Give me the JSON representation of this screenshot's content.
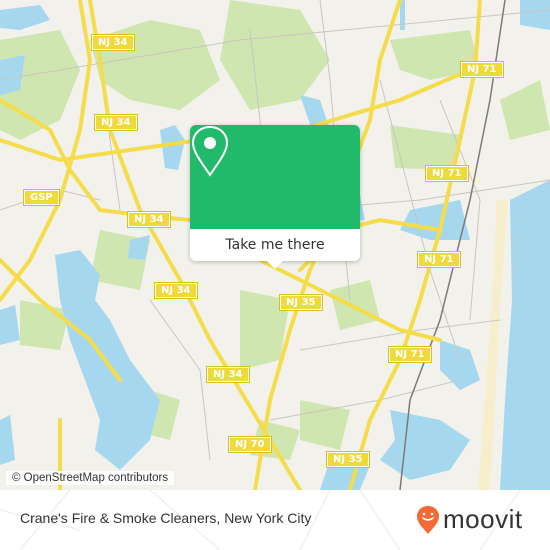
{
  "map": {
    "road_labels": [
      {
        "id": "nj34-a",
        "text": "NJ 34"
      },
      {
        "id": "nj34-b",
        "text": "NJ 34"
      },
      {
        "id": "gsp",
        "text": "GSP"
      },
      {
        "id": "nj34-c",
        "text": "NJ 34"
      },
      {
        "id": "nj34-d",
        "text": "NJ 34"
      },
      {
        "id": "nj34-e",
        "text": "NJ 34"
      },
      {
        "id": "nj35-a",
        "text": "NJ 35"
      },
      {
        "id": "nj70",
        "text": "NJ 70"
      },
      {
        "id": "nj35-b",
        "text": "NJ 35"
      },
      {
        "id": "nj71-a",
        "text": "NJ 71"
      },
      {
        "id": "nj71-b",
        "text": "NJ 71"
      },
      {
        "id": "nj71-c",
        "text": "NJ 71"
      },
      {
        "id": "nj71-d",
        "text": "NJ 71"
      }
    ],
    "colors": {
      "land": "#f2f1ec",
      "park": "#cfe6b0",
      "water": "#a5d8ee",
      "road": "#f5dc4a",
      "beach": "#f7eecb"
    }
  },
  "popup": {
    "icon": "location-pin-icon",
    "action_label": "Take me there",
    "color": "#21ba6a"
  },
  "attribution": "© OpenStreetMap contributors",
  "footer": {
    "title": "Crane's Fire & Smoke Cleaners, New York City",
    "logo_text": "moovit",
    "logo_color": "#f26a35"
  }
}
